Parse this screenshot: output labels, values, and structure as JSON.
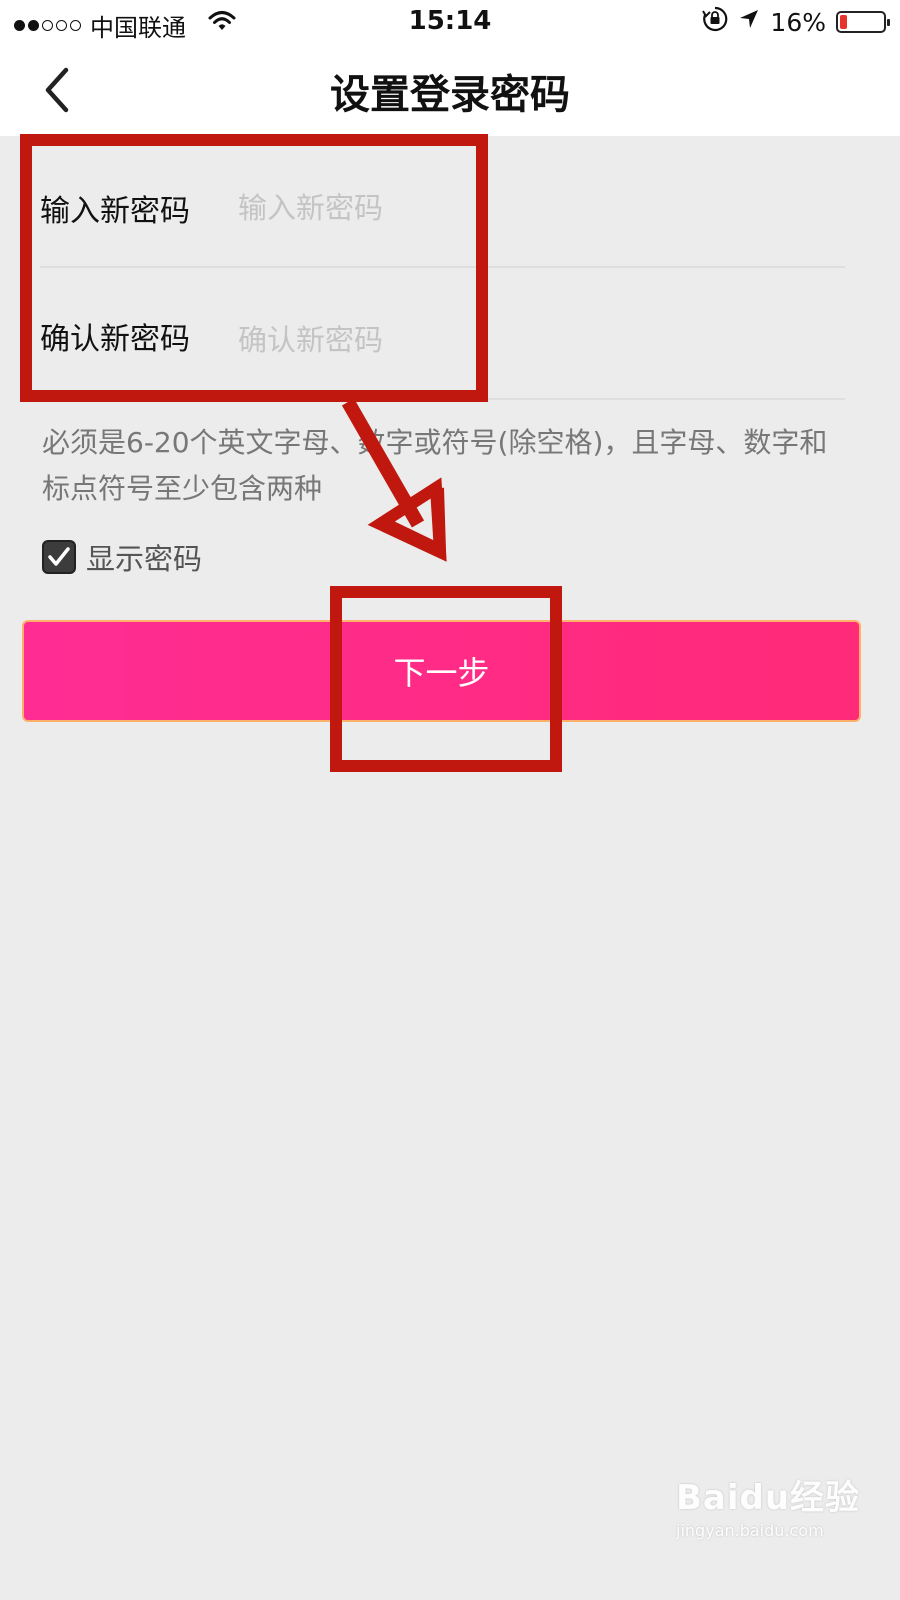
{
  "status_bar": {
    "signal_dots": [
      "full",
      "full",
      "empty",
      "empty",
      "empty"
    ],
    "carrier": "中国联通",
    "time": "15:14",
    "battery_percent": "16%",
    "battery_level": 0.16,
    "icons": [
      "wifi-icon",
      "rotation-lock-icon",
      "location-arrow-icon",
      "battery-icon"
    ]
  },
  "nav": {
    "title": "设置登录密码",
    "back_icon": "chevron-left-icon"
  },
  "form": {
    "new_password": {
      "label": "输入新密码",
      "value": "",
      "placeholder": "输入新密码"
    },
    "confirm_password": {
      "label": "确认新密码",
      "value": "",
      "placeholder": "确认新密码"
    }
  },
  "hint": "必须是6-20个英文字母、数字或符号(除空格)，且字母、数字和标点符号至少包含两种",
  "show_password": {
    "label": "显示密码",
    "checked": true
  },
  "next_button": {
    "label": "下一步"
  },
  "colors": {
    "accent": "#ff2a86",
    "annotation": "#c0180e",
    "background": "#ececec"
  },
  "watermark": {
    "brand": "Baidu经验",
    "url": "jingyan.baidu.com"
  }
}
